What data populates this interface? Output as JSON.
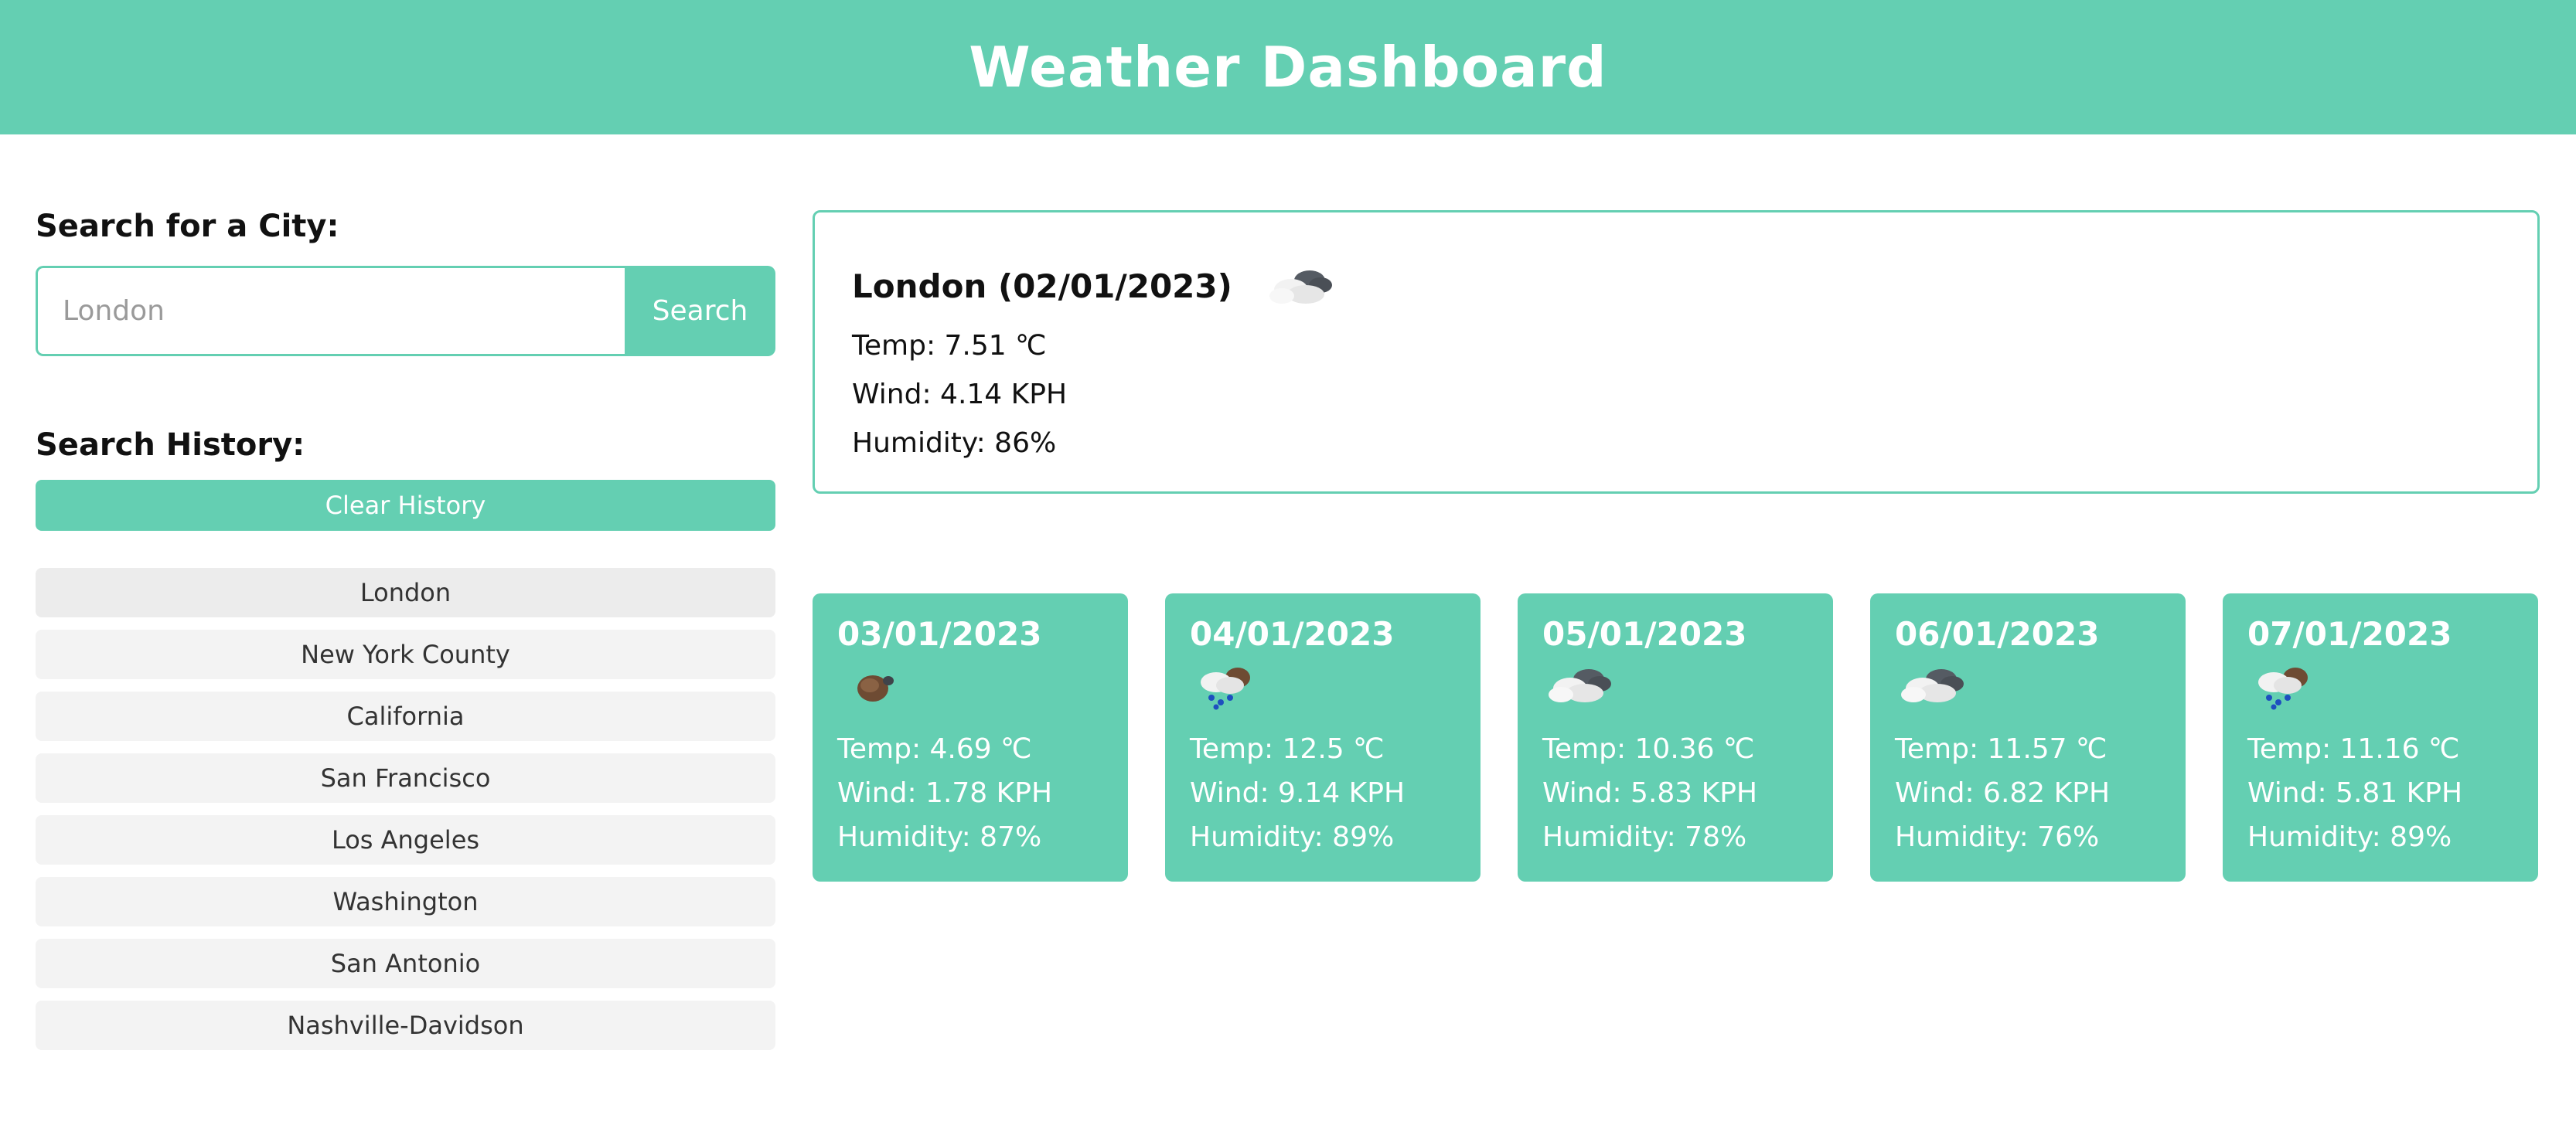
{
  "header": {
    "title": "Weather Dashboard"
  },
  "search": {
    "label": "Search for a City:",
    "placeholder": "London",
    "button_label": "Search"
  },
  "history": {
    "label": "Search History:",
    "clear_label": "Clear History",
    "items": [
      "London",
      "New York County",
      "California",
      "San Francisco",
      "Los Angeles",
      "Washington",
      "San Antonio",
      "Nashville-Davidson"
    ]
  },
  "current": {
    "title": "London (02/01/2023)",
    "icon": "broken-clouds-icon",
    "temp": "Temp: 7.51 ℃",
    "wind": "Wind: 4.14 KPH",
    "humidity": "Humidity: 86%"
  },
  "forecast": [
    {
      "date": "03/01/2023",
      "icon": "overcast-clouds-icon",
      "temp": "Temp: 4.69 ℃",
      "wind": "Wind: 1.78 KPH",
      "humidity": "Humidity: 87%"
    },
    {
      "date": "04/01/2023",
      "icon": "rain-icon",
      "temp": "Temp: 12.5 ℃",
      "wind": "Wind: 9.14 KPH",
      "humidity": "Humidity: 89%"
    },
    {
      "date": "05/01/2023",
      "icon": "broken-clouds-icon",
      "temp": "Temp: 10.36 ℃",
      "wind": "Wind: 5.83 KPH",
      "humidity": "Humidity: 78%"
    },
    {
      "date": "06/01/2023",
      "icon": "broken-clouds-icon",
      "temp": "Temp: 11.57 ℃",
      "wind": "Wind: 6.82 KPH",
      "humidity": "Humidity: 76%"
    },
    {
      "date": "07/01/2023",
      "icon": "rain-icon",
      "temp": "Temp: 11.16 ℃",
      "wind": "Wind: 5.81 KPH",
      "humidity": "Humidity: 89%"
    }
  ],
  "colors": {
    "accent": "#64cfb2",
    "history_bg": "#f3f3f3"
  }
}
